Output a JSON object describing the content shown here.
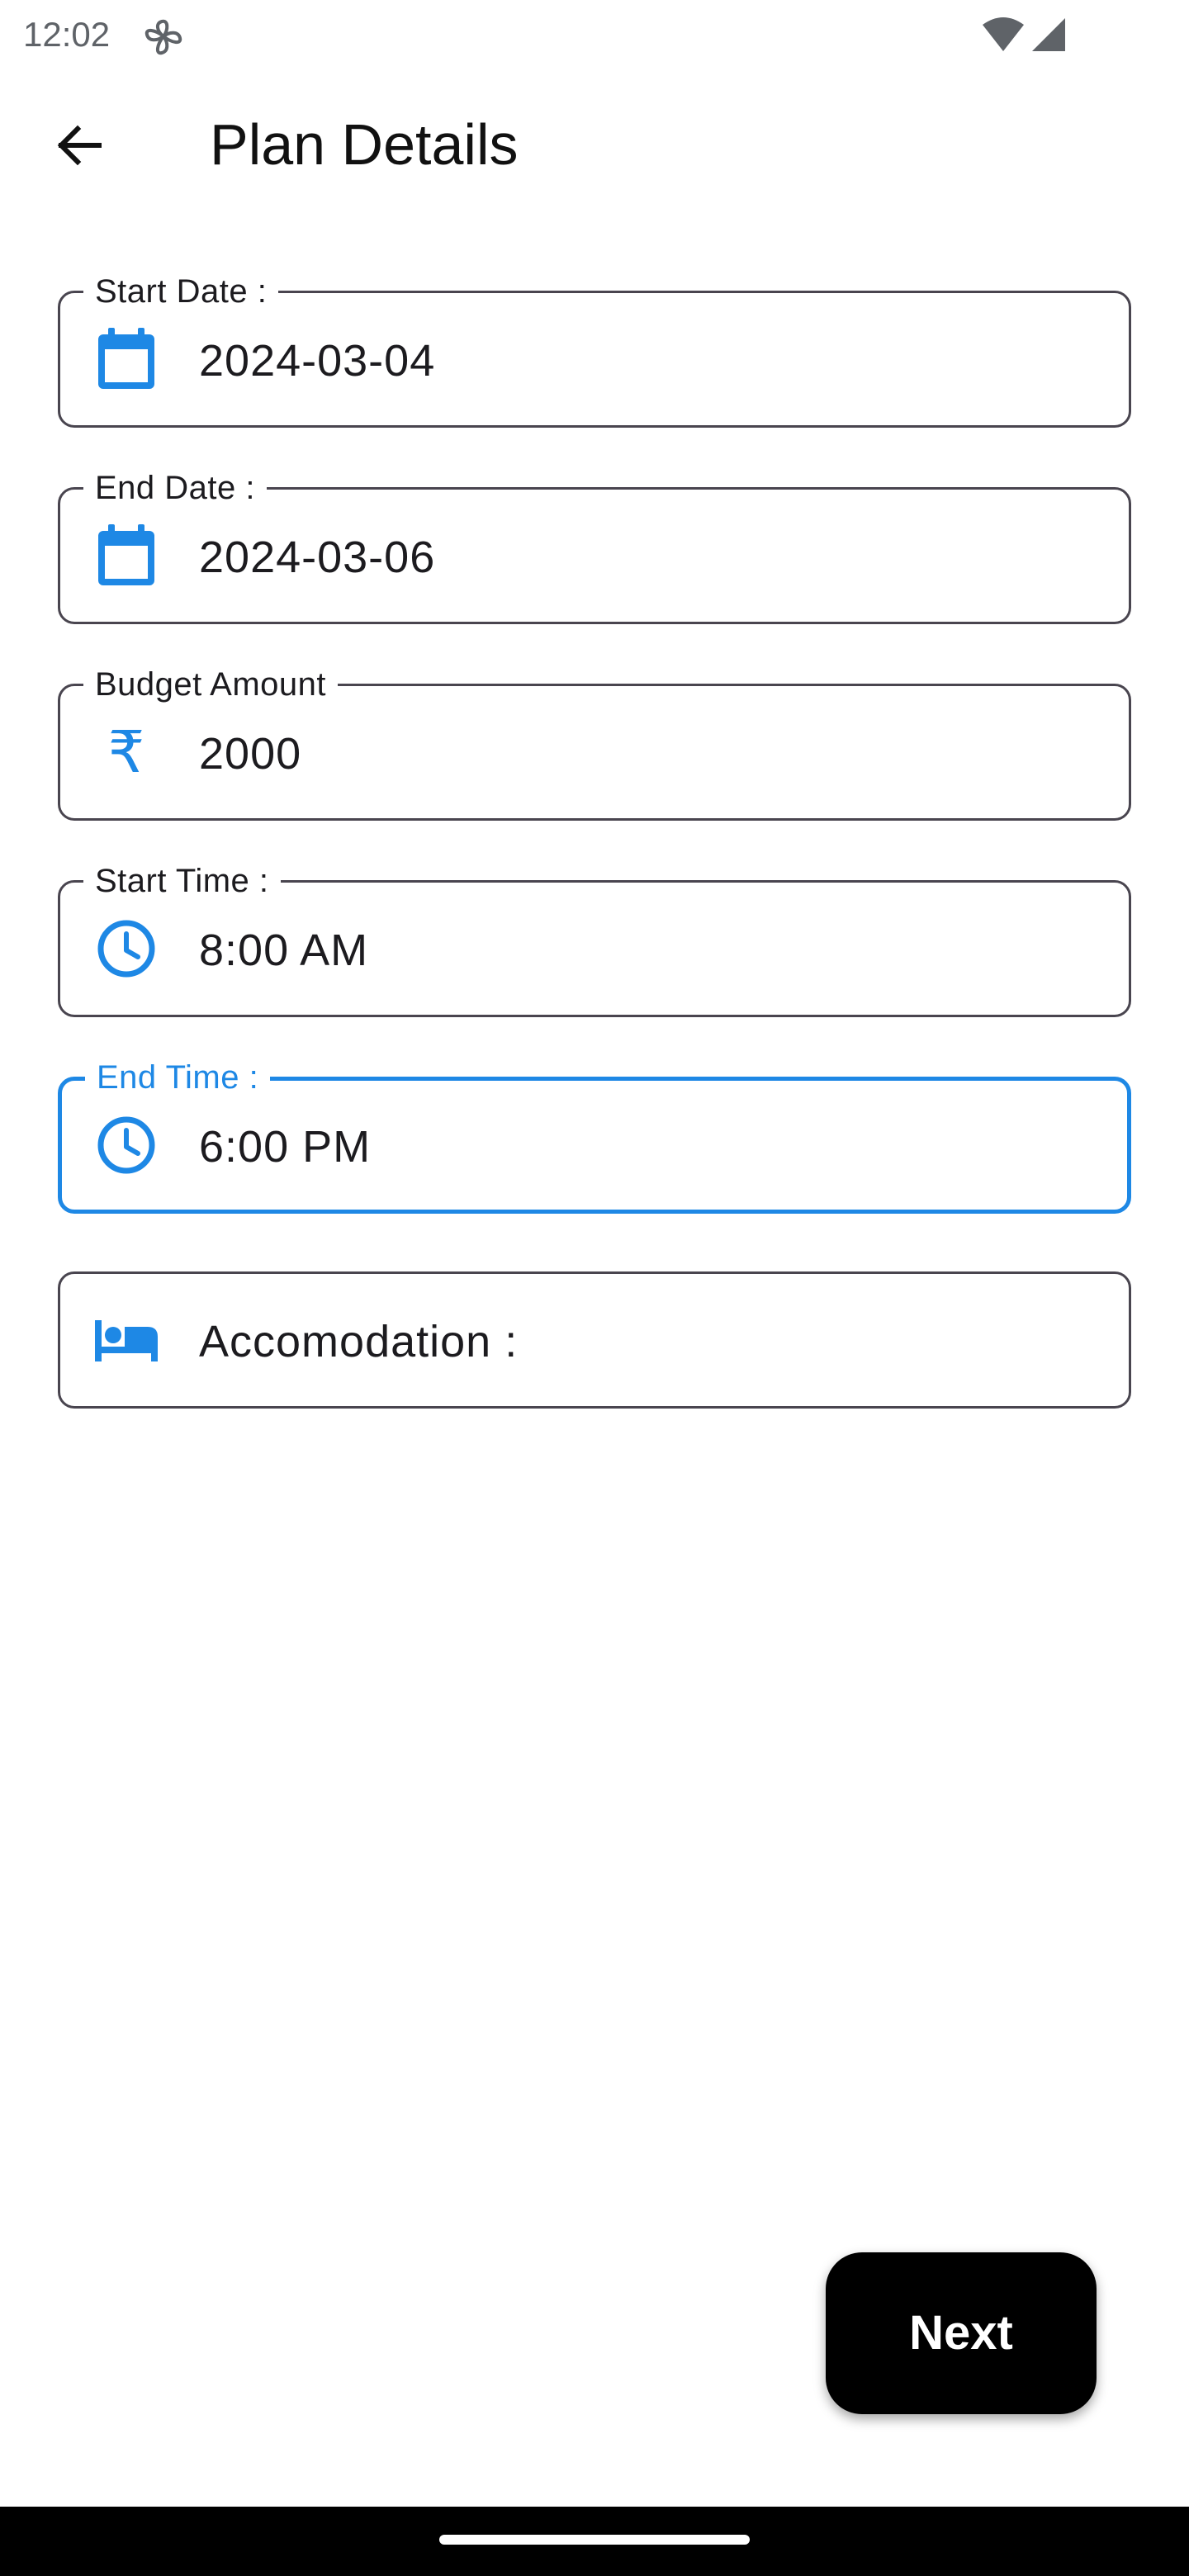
{
  "status_bar": {
    "time": "12:02",
    "icons": [
      "fan-icon",
      "wifi-icon",
      "cell-signal-icon"
    ]
  },
  "app_bar": {
    "title": "Plan Details",
    "back_icon": "arrow-back-icon"
  },
  "form": {
    "start_date": {
      "label": "Start Date :",
      "value": "2024-03-04",
      "icon": "calendar-icon"
    },
    "end_date": {
      "label": "End Date :",
      "value": "2024-03-06",
      "icon": "calendar-icon"
    },
    "budget": {
      "label": "Budget Amount",
      "value": "2000",
      "icon": "rupee-icon",
      "icon_glyph": "₹"
    },
    "start_time": {
      "label": "Start Time :",
      "value": "8:00 AM",
      "icon": "clock-icon"
    },
    "end_time": {
      "label": "End Time :",
      "value": "6:00 PM",
      "icon": "clock-icon",
      "focused": true
    },
    "accommodation": {
      "value": "Accomodation :",
      "icon": "bed-icon"
    }
  },
  "actions": {
    "next_label": "Next"
  },
  "colors": {
    "accent": "#1e88e5",
    "outline": "#49454f",
    "button_bg": "#000000",
    "button_text": "#ffffff"
  }
}
